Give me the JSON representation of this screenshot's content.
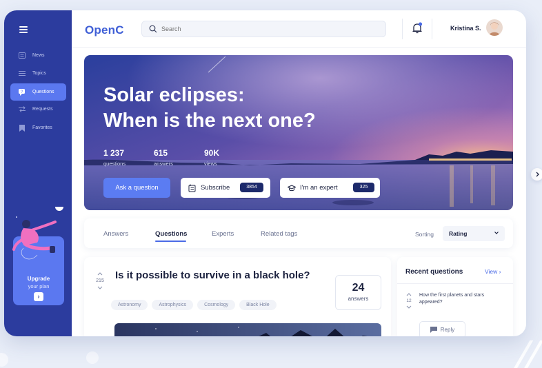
{
  "app": {
    "logo": "OpenC"
  },
  "sidebar": {
    "items": [
      {
        "label": "News",
        "icon": "news-icon"
      },
      {
        "label": "Topics",
        "icon": "list-icon"
      },
      {
        "label": "Questions",
        "icon": "question-icon",
        "active": true
      },
      {
        "label": "Requests",
        "icon": "swap-icon"
      },
      {
        "label": "Favorites",
        "icon": "bookmark-icon"
      }
    ],
    "upgrade": {
      "title": "Upgrade",
      "subtitle": "your plan",
      "arrow": "›"
    }
  },
  "header": {
    "search": {
      "placeholder": "Search",
      "value": ""
    },
    "user": {
      "name": "Kristina S."
    }
  },
  "hero": {
    "title_line1": "Solar eclipses:",
    "title_line2": "When is the next one?",
    "stats": [
      {
        "value": "1 237",
        "label": "questions"
      },
      {
        "value": "615",
        "label": "answers"
      },
      {
        "value": "90K",
        "label": "views"
      }
    ],
    "ask_button": "Ask a question",
    "subscribe": {
      "label": "Subscribe",
      "count": "3854"
    },
    "expert": {
      "label": "I'm an expert",
      "count": "325"
    }
  },
  "tabs": {
    "items": [
      "Answers",
      "Questions",
      "Experts",
      "Related tags"
    ],
    "active": "Questions",
    "sorting_label": "Sorting",
    "sorting_value": "Rating"
  },
  "question": {
    "votes": "215",
    "title": "Is it possible to survive in a black hole?",
    "tags": [
      "Astronomy",
      "Astrophysics",
      "Cosmology",
      "Black Hole"
    ],
    "answers_count": "24",
    "answers_label": "answers"
  },
  "recent": {
    "title": "Recent questions",
    "view_link": "View ›",
    "item": {
      "votes": "12",
      "text": "How the first planets and stars appeared?",
      "reply_label": "Reply"
    }
  },
  "colors": {
    "sidebar": "#2c3c9e",
    "accent": "#5b78f0",
    "badge": "#1d2a6b"
  }
}
